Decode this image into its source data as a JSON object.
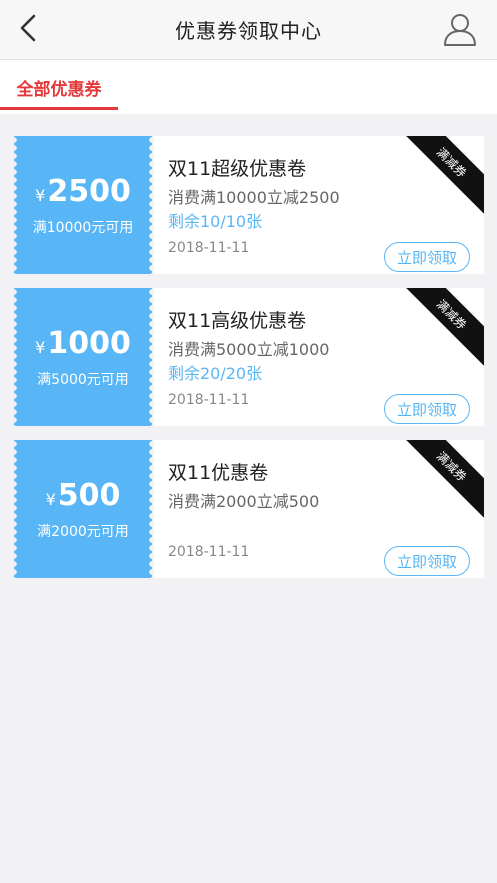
{
  "header": {
    "title": "优惠券领取中心",
    "back_icon": "chevron-left-icon",
    "user_icon": "user-icon"
  },
  "tabs": [
    {
      "label": "全部优惠券",
      "active": true
    }
  ],
  "colors": {
    "accent": "#e4393c",
    "coupon_blue": "#59b6f6",
    "background": "#f2f2f5"
  },
  "coupons": [
    {
      "currency": "¥",
      "amount": "2500",
      "condition": "满10000元可用",
      "title": "双11超级优惠卷",
      "description": "消费满10000立减2500",
      "stock": "剩余10/10张",
      "date": "2018-11-11",
      "button": "立即领取",
      "ribbon": "满减券"
    },
    {
      "currency": "¥",
      "amount": "1000",
      "condition": "满5000元可用",
      "title": "双11高级优惠卷",
      "description": "消费满5000立减1000",
      "stock": "剩余20/20张",
      "date": "2018-11-11",
      "button": "立即领取",
      "ribbon": "满减券"
    },
    {
      "currency": "¥",
      "amount": "500",
      "condition": "满2000元可用",
      "title": "双11优惠卷",
      "description": "消费满2000立减500",
      "stock": "",
      "date": "2018-11-11",
      "button": "立即领取",
      "ribbon": "满减券"
    }
  ]
}
